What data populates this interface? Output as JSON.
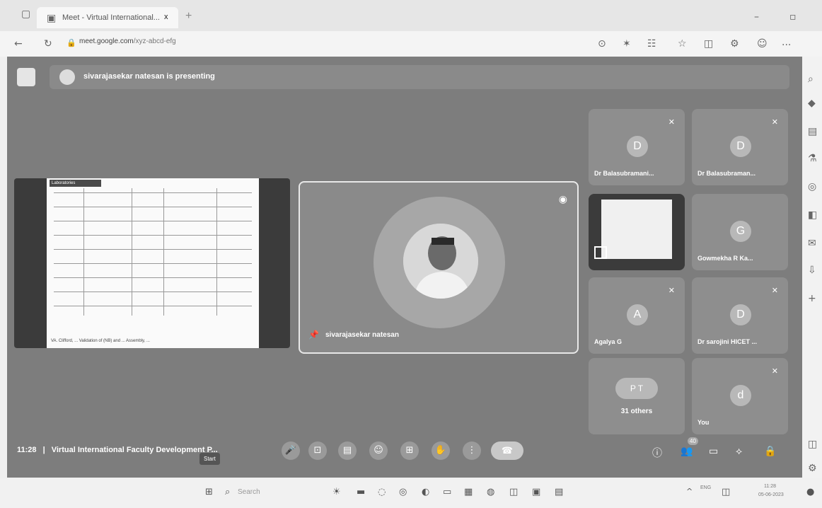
{
  "browser": {
    "tab_title": "Meet - Virtual International...",
    "tab_close": "x",
    "new_tab": "+",
    "url_domain": "meet.google.com",
    "url_rest": "/xyz-abcd-efg",
    "menu": "..."
  },
  "meet": {
    "presenting_banner": "sivarajasekar natesan is presenting",
    "shared_doc_header": "Laboratories",
    "shared_doc_caption": "VA. Clifford, ... Validation of (NB) and ... Assembly, ...",
    "speaker_name": "sivarajasekar natesan",
    "tiles": [
      {
        "initial": "D",
        "name": "Dr Balasubramani..."
      },
      {
        "initial": "D",
        "name": "Dr Balasubraman..."
      },
      {
        "initial": "",
        "name": ""
      },
      {
        "initial": "G",
        "name": "Gowmekha R Ka..."
      },
      {
        "initial": "A",
        "name": "Agalya G"
      },
      {
        "initial": "D",
        "name": "Dr sarojini HICET ..."
      },
      {
        "initial": "P T",
        "name": "31 others"
      },
      {
        "initial": "d",
        "name": "You"
      }
    ],
    "time": "11:28",
    "separator": "|",
    "meeting_title": "Virtual International Faculty Development P...",
    "tooltip": "Start",
    "people_count": "40"
  },
  "taskbar": {
    "search_placeholder": "Search",
    "lang": "ENG",
    "clock_time": "11:28",
    "clock_date": "05-06-2023"
  },
  "colors": {
    "meet_bg": "#7d7d7d",
    "tile_bg": "#8e8e8e",
    "end_call": "#c8c8c8"
  }
}
